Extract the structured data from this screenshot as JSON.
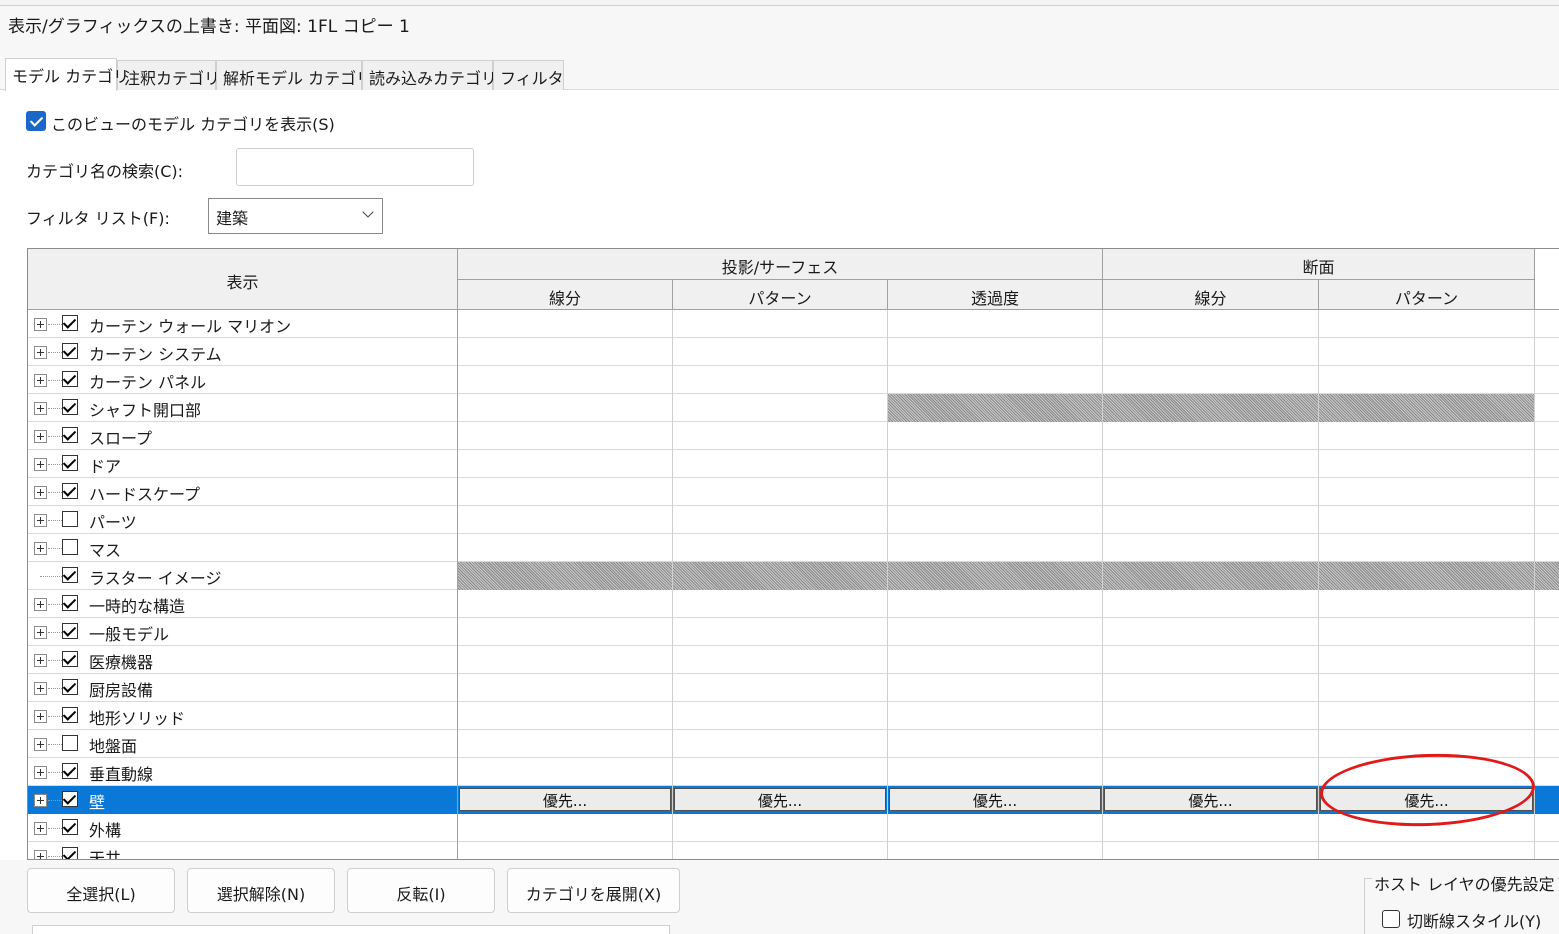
{
  "dialog": {
    "title": "表示/グラフィックスの上書き: 平面図: 1FL コピー 1"
  },
  "tabs": [
    "モデル カテゴリ",
    "注釈カテゴリ",
    "解析モデル カテゴリ",
    "読み込みカテゴリ",
    "フィルタ"
  ],
  "show_model": {
    "label": "このビューのモデル カテゴリを表示(S)",
    "checked": true
  },
  "search": {
    "label": "カテゴリ名の検索(C):",
    "value": ""
  },
  "filter_list": {
    "label": "フィルタ リスト(F):",
    "value": "建築"
  },
  "table": {
    "header": {
      "visibility": "表示",
      "projection": "投影/サーフェス",
      "cut": "断面",
      "proj_lines": "線分",
      "proj_pattern": "パターン",
      "transparency": "透過度",
      "cut_lines": "線分",
      "cut_pattern": "パターン"
    },
    "override_label": "優先...",
    "rows": [
      {
        "name": "カーテン ウォール マリオン",
        "checked": true,
        "expand": true,
        "hatch": "none"
      },
      {
        "name": "カーテン システム",
        "checked": true,
        "expand": true,
        "hatch": "none"
      },
      {
        "name": "カーテン パネル",
        "checked": true,
        "expand": true,
        "hatch": "none"
      },
      {
        "name": "シャフト開口部",
        "checked": true,
        "expand": true,
        "hatch": "partial"
      },
      {
        "name": "スロープ",
        "checked": true,
        "expand": true,
        "hatch": "none"
      },
      {
        "name": "ドア",
        "checked": true,
        "expand": true,
        "hatch": "none"
      },
      {
        "name": "ハードスケープ",
        "checked": true,
        "expand": true,
        "hatch": "none"
      },
      {
        "name": "パーツ",
        "checked": false,
        "expand": true,
        "hatch": "none"
      },
      {
        "name": "マス",
        "checked": false,
        "expand": true,
        "hatch": "none"
      },
      {
        "name": "ラスター イメージ",
        "checked": true,
        "expand": false,
        "hatch": "full"
      },
      {
        "name": "一時的な構造",
        "checked": true,
        "expand": true,
        "hatch": "none"
      },
      {
        "name": "一般モデル",
        "checked": true,
        "expand": true,
        "hatch": "none"
      },
      {
        "name": "医療機器",
        "checked": true,
        "expand": true,
        "hatch": "none"
      },
      {
        "name": "厨房設備",
        "checked": true,
        "expand": true,
        "hatch": "none"
      },
      {
        "name": "地形ソリッド",
        "checked": true,
        "expand": true,
        "hatch": "none"
      },
      {
        "name": "地盤面",
        "checked": false,
        "expand": true,
        "hatch": "none"
      },
      {
        "name": "垂直動線",
        "checked": true,
        "expand": true,
        "hatch": "none"
      },
      {
        "name": "壁",
        "checked": true,
        "expand": true,
        "hatch": "none",
        "selected": true
      },
      {
        "name": "外構",
        "checked": true,
        "expand": true,
        "hatch": "none"
      },
      {
        "name": "天井",
        "checked": true,
        "expand": true,
        "hatch": "none"
      }
    ]
  },
  "buttons": {
    "select_all": "全選択(L)",
    "deselect": "選択解除(N)",
    "invert": "反転(I)",
    "expand": "カテゴリを展開(X)"
  },
  "host_layer": {
    "title": "ホスト レイヤの優先設定",
    "cut_line_style": {
      "label": "切断線スタイル(Y)",
      "checked": false
    }
  },
  "colors": {
    "selection": "#0a78d7",
    "annotation": "#e01a1a",
    "checkbox_accent": "#1a66c9"
  }
}
